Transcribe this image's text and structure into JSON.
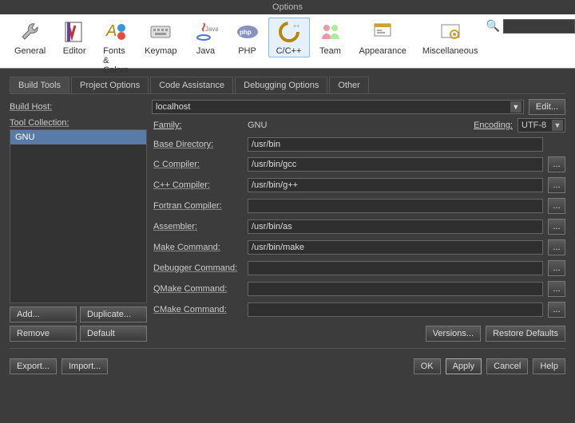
{
  "window": {
    "title": "Options"
  },
  "toolbar": {
    "categories": [
      {
        "id": "general",
        "label": "General"
      },
      {
        "id": "editor",
        "label": "Editor"
      },
      {
        "id": "fonts",
        "label": "Fonts & Colors"
      },
      {
        "id": "keymap",
        "label": "Keymap"
      },
      {
        "id": "java",
        "label": "Java"
      },
      {
        "id": "php",
        "label": "PHP"
      },
      {
        "id": "ccpp",
        "label": "C/C++"
      },
      {
        "id": "team",
        "label": "Team"
      },
      {
        "id": "appearance",
        "label": "Appearance"
      },
      {
        "id": "misc",
        "label": "Miscellaneous"
      }
    ],
    "selected": "ccpp",
    "search_placeholder": ""
  },
  "tabs": {
    "items": [
      "Build Tools",
      "Project Options",
      "Code Assistance",
      "Debugging Options",
      "Other"
    ],
    "active": 0
  },
  "buildhost": {
    "label": "Build Host:",
    "value": "localhost",
    "edit": "Edit..."
  },
  "toolcoll": {
    "label": "Tool Collection:",
    "items": [
      "GNU"
    ],
    "selected": 0,
    "buttons": {
      "add": "Add...",
      "duplicate": "Duplicate...",
      "remove": "Remove",
      "default": "Default"
    }
  },
  "family": {
    "label": "Family:",
    "value": "GNU"
  },
  "encoding": {
    "label": "Encoding:",
    "value": "UTF-8"
  },
  "fields": [
    {
      "label": "Base Directory:",
      "value": "/usr/bin",
      "browse": false
    },
    {
      "label": "C Compiler:",
      "value": "/usr/bin/gcc",
      "browse": true
    },
    {
      "label": "C++ Compiler:",
      "value": "/usr/bin/g++",
      "browse": true
    },
    {
      "label": "Fortran Compiler:",
      "value": "",
      "browse": true
    },
    {
      "label": "Assembler:",
      "value": "/usr/bin/as",
      "browse": true
    },
    {
      "label": "Make Command:",
      "value": "/usr/bin/make",
      "browse": true
    },
    {
      "label": "Debugger Command:",
      "value": "",
      "browse": true
    },
    {
      "label": "QMake Command:",
      "value": "",
      "browse": true
    },
    {
      "label": "CMake Command:",
      "value": "",
      "browse": true
    }
  ],
  "rightbuttons": {
    "versions": "Versions...",
    "restore": "Restore Defaults"
  },
  "footer": {
    "export": "Export...",
    "import": "Import...",
    "ok": "OK",
    "apply": "Apply",
    "cancel": "Cancel",
    "help": "Help"
  }
}
